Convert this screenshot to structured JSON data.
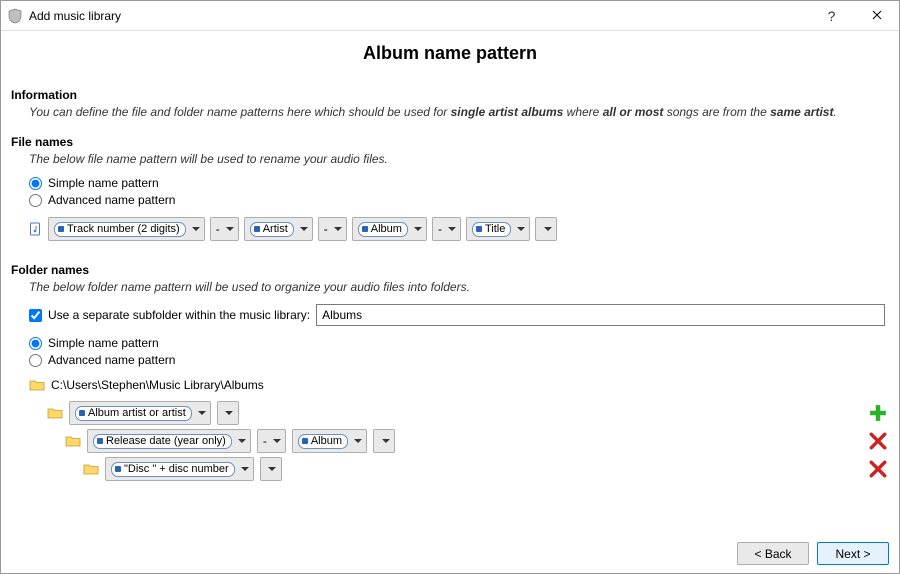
{
  "window": {
    "title": "Add music library"
  },
  "page": {
    "heading": "Album name pattern"
  },
  "info": {
    "heading": "Information",
    "desc_pre": "You can define the file and folder name patterns here which should be used for ",
    "desc_b1": "single artist albums",
    "desc_mid1": " where ",
    "desc_b2": "all or most",
    "desc_mid2": " songs are from the ",
    "desc_b3": "same artist",
    "desc_post": "."
  },
  "filenames": {
    "heading": "File names",
    "desc": "The below file name pattern will be used to rename your audio files.",
    "radio_simple": "Simple name pattern",
    "radio_advanced": "Advanced name pattern",
    "tokens": {
      "t1": "Track number (2 digits)",
      "sep1": "-",
      "t2": "Artist",
      "sep2": "-",
      "t3": "Album",
      "sep3": "-",
      "t4": "Title"
    }
  },
  "foldernames": {
    "heading": "Folder names",
    "desc": "The below folder name pattern will be used to organize your audio files into folders.",
    "checkbox_label": "Use a separate subfolder within the music library:",
    "subfolder_value": "Albums",
    "radio_simple": "Simple name pattern",
    "radio_advanced": "Advanced name pattern",
    "root_path": "C:\\Users\\Stephen\\Music Library\\Albums",
    "level1": {
      "t1": "Album artist or artist"
    },
    "level2": {
      "t1": "Release date (year only)",
      "sep1": "-",
      "t2": "Album"
    },
    "level3": {
      "t1": "\"Disc \" + disc number"
    }
  },
  "footer": {
    "back": "< Back",
    "next": "Next >"
  }
}
